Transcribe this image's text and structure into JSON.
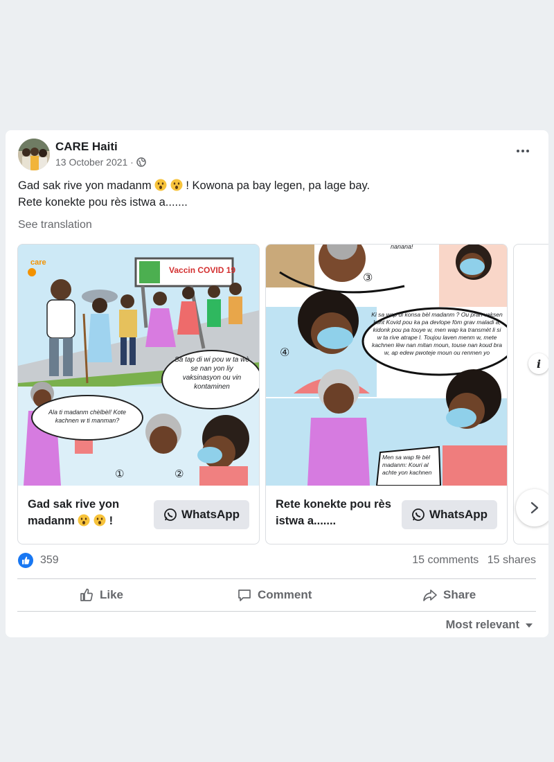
{
  "post": {
    "page_name": "CARE Haiti",
    "date": "13 October 2021 ·",
    "text_line1_before": "Gad sak rive yon madanm",
    "text_line1_after": "! Kowona pa bay legen, pa lage bay.",
    "text_line2": "Rete konekte pou rès istwa a.......",
    "see_translation": "See translation"
  },
  "cards": [
    {
      "title": "Gad sak rive yon madanm",
      "title_suffix": "!",
      "button_label": "WhatsApp",
      "logo": "care",
      "sign": "Vaccin COVID 19",
      "bubble1": "Ala ti madanm chèlbèl! Kote kachnen w ti manman?",
      "bubble2": "Sa tap di wi pou w ta wè se nan yon liy vaksinasyon ou vin kontaminen",
      "panel1": "①",
      "panel2": "②"
    },
    {
      "title": "Rete konekte pou rès istwa a.......",
      "button_label": "WhatsApp",
      "bubble_top": "nanana!",
      "bubble_main": "Ki sa wap di konsa bèl madanm ? Ou pran vaksen kont Kovid pou ka pa devlope fòm grav maladi a, kidonk pou pa touye w, men wap ka transmèt li si w ta rive atrape l. Toujou laven menm w, mete kachnen lèw nan mitan moun, touse nan koud bra w, ap edew pwoteje moun ou renmen yo",
      "bubble_bottom": "Men sa wap fè bèl madanm: Kouri al achte yon kachnen",
      "panel3": "③",
      "panel4": "④"
    }
  ],
  "reactions": {
    "count": "359"
  },
  "counts": {
    "comments": "15 comments",
    "shares": "15 shares"
  },
  "actions": {
    "like": "Like",
    "comment": "Comment",
    "share": "Share"
  },
  "sort": {
    "label": "Most relevant"
  },
  "colors": {
    "brand": "#1877f2",
    "care_orange": "#f39200",
    "whatsapp_bg": "#e4e6eb"
  },
  "icons": [
    "globe-icon",
    "more-icon",
    "whatsapp-icon",
    "like-icon",
    "comment-icon",
    "share-icon",
    "info-icon",
    "chevron-right-icon",
    "chevron-down-icon"
  ]
}
